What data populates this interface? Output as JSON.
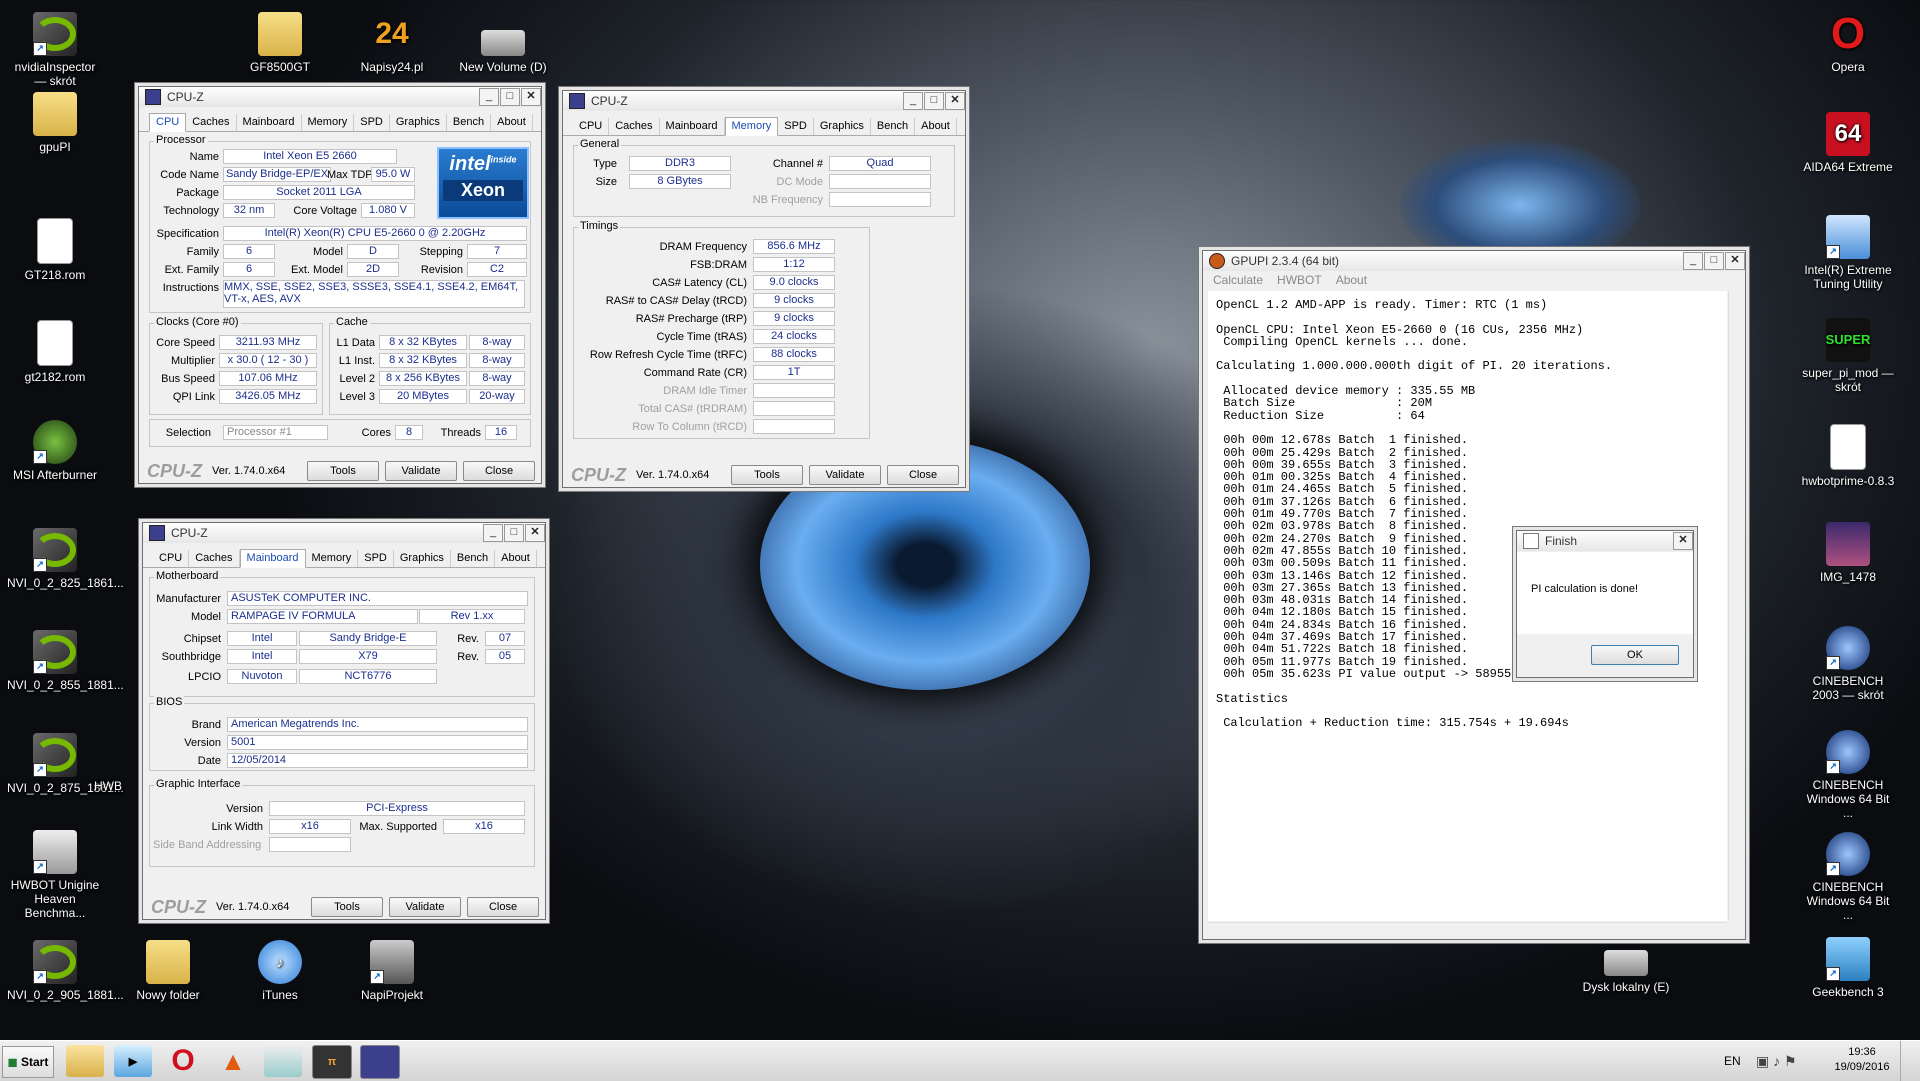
{
  "desktop": {
    "left_icons": [
      "nvidiaInspector — skrót",
      "gpuPI",
      "GT218.rom",
      "gt2182.rom",
      "MSI Afterburner",
      "NVI_0_2_825_1861...",
      "NVI_0_2_855_1881...",
      "NVI_0_2_875_1861...",
      "HWBOT Unigine Heaven Benchma...",
      "NVI_0_2_905_1881..."
    ],
    "hwb_label": "HWB",
    "top_icons": [
      "GF8500GT",
      "Napisy24.pl",
      "New Volume (D)"
    ],
    "bottom_icons": [
      "Nowy folder",
      "iTunes",
      "NapiProjekt"
    ],
    "right_icons": [
      "Opera",
      "AIDA64 Extreme",
      "Intel(R) Extreme Tuning Utility",
      "super_pi_mod — skrót",
      "hwbotprime-0.8.3",
      "IMG_1478",
      "CINEBENCH 2003 — skrót",
      "CINEBENCH Windows 64 Bit ...",
      "CINEBENCH Windows 64 Bit ...",
      "Geekbench 3"
    ],
    "drive_e": "Dysk lokalny (E)",
    "napisy_badge": "24",
    "aida_badge": "64"
  },
  "cpuz_common": {
    "title": "CPU-Z",
    "logo": "CPU-Z",
    "version": "Ver. 1.74.0.x64",
    "tools": "Tools",
    "validate": "Validate",
    "close": "Close",
    "tabs": [
      "CPU",
      "Caches",
      "Mainboard",
      "Memory",
      "SPD",
      "Graphics",
      "Bench",
      "About"
    ]
  },
  "cpu": {
    "processor_group": "Processor",
    "name_lbl": "Name",
    "name": "Intel Xeon E5 2660",
    "codename_lbl": "Code Name",
    "codename": "Sandy Bridge-EP/EX",
    "maxtdp_lbl": "Max TDP",
    "maxtdp": "95.0 W",
    "package_lbl": "Package",
    "package": "Socket 2011 LGA",
    "technology_lbl": "Technology",
    "technology": "32 nm",
    "corevolt_lbl": "Core Voltage",
    "corevolt": "1.080 V",
    "spec_lbl": "Specification",
    "spec": "Intel(R) Xeon(R) CPU E5-2660 0 @ 2.20GHz",
    "family_lbl": "Family",
    "family": "6",
    "model_lbl": "Model",
    "model": "D",
    "stepping_lbl": "Stepping",
    "stepping": "7",
    "extfamily_lbl": "Ext. Family",
    "extfamily": "6",
    "extmodel_lbl": "Ext. Model",
    "extmodel": "2D",
    "revision_lbl": "Revision",
    "revision": "C2",
    "instr_lbl": "Instructions",
    "instr": "MMX, SSE, SSE2, SSE3, SSSE3, SSE4.1, SSE4.2, EM64T, VT-x, AES, AVX",
    "clocks_group": "Clocks (Core #0)",
    "corespeed_lbl": "Core Speed",
    "corespeed": "3211.93 MHz",
    "mult_lbl": "Multiplier",
    "mult": "x 30.0 ( 12 - 30 )",
    "busspeed_lbl": "Bus Speed",
    "busspeed": "107.06 MHz",
    "qpi_lbl": "QPI Link",
    "qpi": "3426.05 MHz",
    "cache_group": "Cache",
    "l1d_lbl": "L1 Data",
    "l1d": "8 x 32 KBytes",
    "l1d_way": "8-way",
    "l1i_lbl": "L1 Inst.",
    "l1i": "8 x 32 KBytes",
    "l1i_way": "8-way",
    "l2_lbl": "Level 2",
    "l2": "8 x 256 KBytes",
    "l2_way": "8-way",
    "l3_lbl": "Level 3",
    "l3": "20 MBytes",
    "l3_way": "20-way",
    "selection_lbl": "Selection",
    "selection": "Processor #1",
    "cores_lbl": "Cores",
    "cores": "8",
    "threads_lbl": "Threads",
    "threads": "16",
    "intel_top": "intel",
    "intel_inside": "inside",
    "intel_brand": "Xeon"
  },
  "memory": {
    "general_group": "General",
    "type_lbl": "Type",
    "type": "DDR3",
    "channel_lbl": "Channel #",
    "channel": "Quad",
    "size_lbl": "Size",
    "size": "8 GBytes",
    "dcmode_lbl": "DC Mode",
    "nbfreq_lbl": "NB Frequency",
    "timings_group": "Timings",
    "rows": [
      {
        "l": "DRAM Frequency",
        "v": "856.6 MHz"
      },
      {
        "l": "FSB:DRAM",
        "v": "1:12"
      },
      {
        "l": "CAS# Latency (CL)",
        "v": "9.0 clocks"
      },
      {
        "l": "RAS# to CAS# Delay (tRCD)",
        "v": "9 clocks"
      },
      {
        "l": "RAS# Precharge (tRP)",
        "v": "9 clocks"
      },
      {
        "l": "Cycle Time (tRAS)",
        "v": "24 clocks"
      },
      {
        "l": "Row Refresh Cycle Time (tRFC)",
        "v": "88 clocks"
      },
      {
        "l": "Command Rate (CR)",
        "v": "1T"
      }
    ],
    "disabled_rows": [
      "DRAM Idle Timer",
      "Total CAS# (tRDRAM)",
      "Row To Column (tRCD)"
    ]
  },
  "mainboard": {
    "mb_group": "Motherboard",
    "manufacturer_lbl": "Manufacturer",
    "manufacturer": "ASUSTeK COMPUTER INC.",
    "model_lbl": "Model",
    "model": "RAMPAGE IV FORMULA",
    "model_rev": "Rev 1.xx",
    "chipset_lbl": "Chipset",
    "chipset_v": "Intel",
    "chipset_n": "Sandy Bridge-E",
    "rev_lbl": "Rev.",
    "chipset_rev": "07",
    "sb_lbl": "Southbridge",
    "sb_v": "Intel",
    "sb_n": "X79",
    "sb_rev": "05",
    "lpcio_lbl": "LPCIO",
    "lpcio_v": "Nuvoton",
    "lpcio_n": "NCT6776",
    "bios_group": "BIOS",
    "brand_lbl": "Brand",
    "brand": "American Megatrends Inc.",
    "version_lbl": "Version",
    "version": "5001",
    "date_lbl": "Date",
    "date": "12/05/2014",
    "gi_group": "Graphic Interface",
    "giver_lbl": "Version",
    "giver": "PCI-Express",
    "lw_lbl": "Link Width",
    "lw": "x16",
    "ms_lbl": "Max. Supported",
    "ms": "x16",
    "sba_lbl": "Side Band Addressing"
  },
  "gpupi": {
    "title": "GPUPI 2.3.4 (64 bit)",
    "menu": [
      "Calculate",
      "HWBOT",
      "About"
    ],
    "console": "OpenCL 1.2 AMD-APP is ready. Timer: RTC (1 ms)\n\nOpenCL CPU: Intel Xeon E5-2660 0 (16 CUs, 2356 MHz)\n Compiling OpenCL kernels ... done.\n\nCalculating 1.000.000.000th digit of PI. 20 iterations.\n\n Allocated device memory : 335.55 MB\n Batch Size              : 20M\n Reduction Size          : 64\n\n 00h 00m 12.678s Batch  1 finished.\n 00h 00m 25.429s Batch  2 finished.\n 00h 00m 39.655s Batch  3 finished.\n 00h 01m 00.325s Batch  4 finished.\n 00h 01m 24.465s Batch  5 finished.\n 00h 01m 37.126s Batch  6 finished.\n 00h 01m 49.770s Batch  7 finished.\n 00h 02m 03.978s Batch  8 finished.\n 00h 02m 24.270s Batch  9 finished.\n 00h 02m 47.855s Batch 10 finished.\n 00h 03m 00.509s Batch 11 finished.\n 00h 03m 13.146s Batch 12 finished.\n 00h 03m 27.365s Batch 13 finished.\n 00h 03m 48.031s Batch 14 finished.\n 00h 04m 12.180s Batch 15 finished.\n 00h 04m 24.834s Batch 16 finished.\n 00h 04m 37.469s Batch 17 finished.\n 00h 04m 51.722s Batch 18 finished.\n 00h 05m 11.977s Batch 19 finished.\n 00h 05m 35.623s PI value output -> 5895585A0\n\nStatistics\n\n Calculation + Reduction time: 315.754s + 19.694s"
  },
  "finish": {
    "title": "Finish",
    "message": "PI calculation is done!",
    "ok": "OK"
  },
  "taskbar": {
    "start": "Start",
    "lang": "EN",
    "time": "19:36",
    "date": "19/09/2016"
  }
}
